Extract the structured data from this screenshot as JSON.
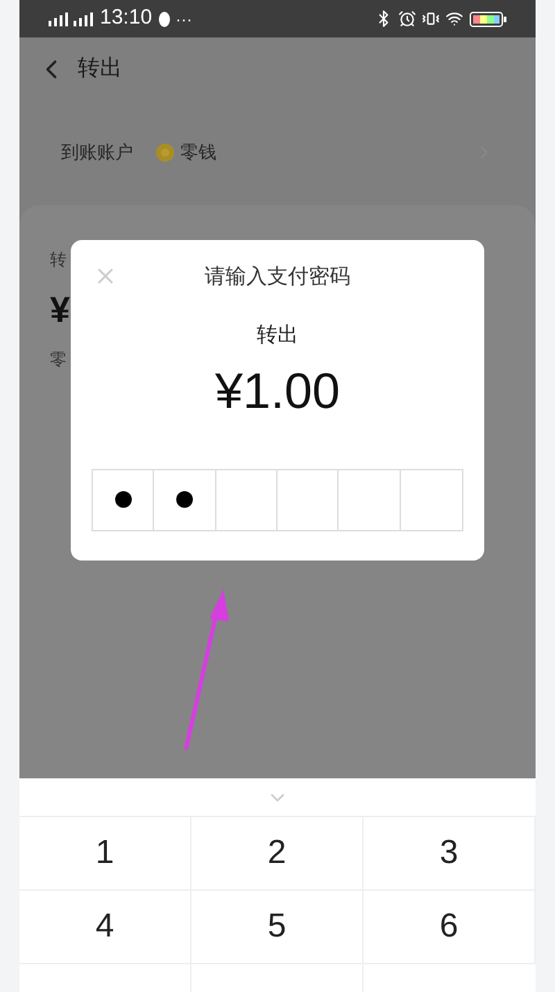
{
  "status_bar": {
    "time": "13:10",
    "more": "···"
  },
  "header": {
    "title": "转出"
  },
  "account_row": {
    "label": "到账账户",
    "value": "零钱"
  },
  "card": {
    "fragments": [
      "转",
      "¥",
      "零"
    ]
  },
  "dialog": {
    "title": "请输入支付密码",
    "subtitle": "转出",
    "amount": "¥1.00",
    "password_boxes": [
      {
        "filled": true
      },
      {
        "filled": true
      },
      {
        "filled": false
      },
      {
        "filled": false
      },
      {
        "filled": false
      },
      {
        "filled": false
      }
    ]
  },
  "keypad": {
    "keys": [
      "1",
      "2",
      "3",
      "4",
      "5",
      "6"
    ]
  }
}
